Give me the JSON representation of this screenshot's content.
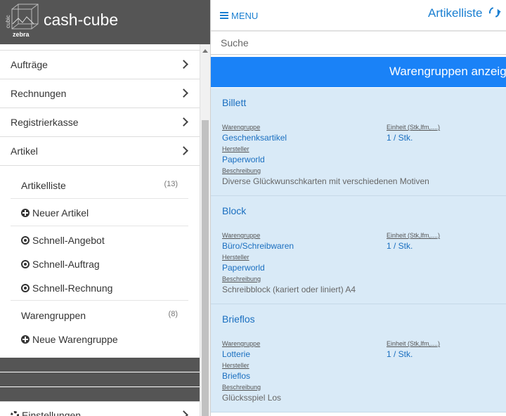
{
  "brand": {
    "name": "cash-cube",
    "logo_top": "cubic",
    "logo_bottom": "zebra"
  },
  "sidebar": {
    "menu": [
      {
        "label": "Aufträge"
      },
      {
        "label": "Rechnungen"
      },
      {
        "label": "Registrierkasse"
      },
      {
        "label": "Artikel"
      }
    ],
    "artikel_sub": {
      "list": {
        "label": "Artikelliste",
        "count": "(13)"
      },
      "new": {
        "label": "Neuer Artikel"
      },
      "quick_offer": {
        "label": "Schnell-Angebot"
      },
      "quick_order": {
        "label": "Schnell-Auftrag"
      },
      "quick_invoice": {
        "label": "Schnell-Rechnung"
      },
      "groups": {
        "label": "Warengruppen",
        "count": "(8)"
      },
      "new_group": {
        "label": "Neue Warengruppe"
      }
    },
    "settings": {
      "label": "Einstellungen"
    }
  },
  "topbar": {
    "menu_label": "MENU",
    "title": "Artikelliste"
  },
  "search": {
    "placeholder": "Suche"
  },
  "banner": {
    "text": "Warengruppen anzeigen"
  },
  "labels": {
    "group": "Warengruppe",
    "unit": "Einheit (Stk,lfm,....)",
    "maker": "Hersteller",
    "desc": "Beschreibung"
  },
  "articles": [
    {
      "name": "Billett",
      "group": "Geschenksartikel",
      "unit": "1 / Stk.",
      "maker": "Paperworld",
      "description": "Diverse Glückwunschkarten mit verschiedenen Motiven"
    },
    {
      "name": "Block",
      "group": "Büro/Schreibwaren",
      "unit": "1 / Stk.",
      "maker": "Paperworld",
      "description": "Schreibblock (kariert oder liniert) A4"
    },
    {
      "name": "Brieflos",
      "group": "Lotterie",
      "unit": "1 / Stk.",
      "maker": "Brieflos",
      "description": "Glücksspiel Los"
    }
  ],
  "colors": {
    "accent": "#1a7fd1",
    "banner": "#1a82f7",
    "card_bg": "#d9eaf7",
    "brand_bg": "#555555"
  }
}
